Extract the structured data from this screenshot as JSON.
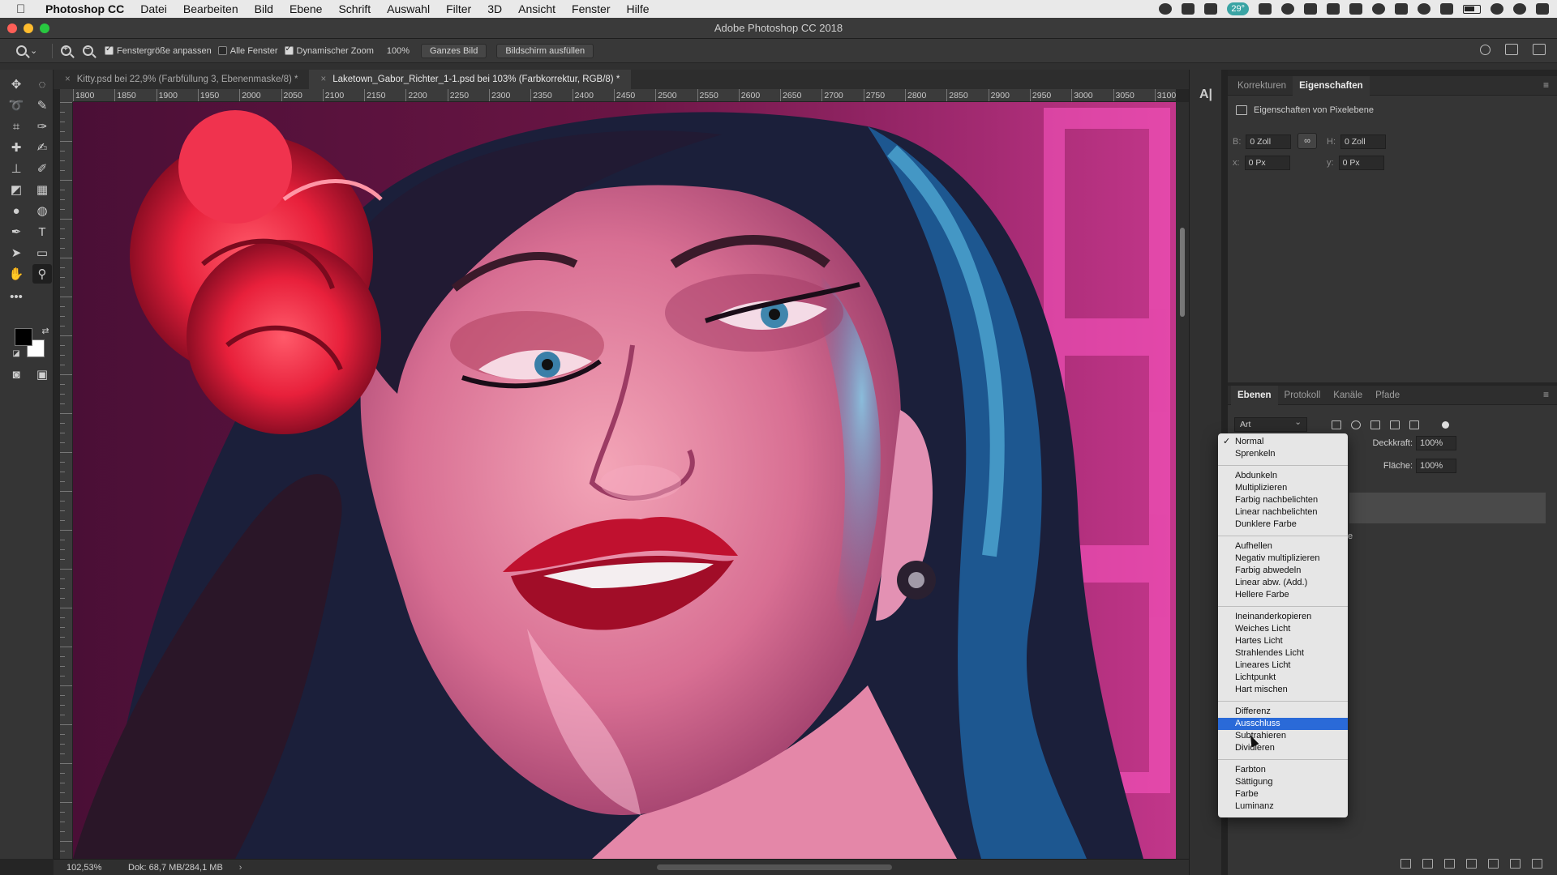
{
  "menubar": {
    "app": "Photoshop CC",
    "items": [
      "Datei",
      "Bearbeiten",
      "Bild",
      "Ebene",
      "Schrift",
      "Auswahl",
      "Filter",
      "3D",
      "Ansicht",
      "Fenster",
      "Hilfe"
    ],
    "badge": "29°"
  },
  "window": {
    "title": "Adobe Photoshop CC 2018"
  },
  "options": {
    "check1": "Fenstergröße anpassen",
    "check2": "Alle Fenster",
    "check3": "Dynamischer Zoom",
    "zoom": "100%",
    "btn1": "Ganzes Bild",
    "btn2": "Bildschirm ausfüllen"
  },
  "tabs": [
    {
      "label": "Kitty.psd bei 22,9% (Farbfüllung 3, Ebenenmaske/8) *"
    },
    {
      "label": "Laketown_Gabor_Richter_1-1.psd bei 103% (Farbkorrektur, RGB/8) *"
    }
  ],
  "ruler_h": [
    "1800",
    "1850",
    "1900",
    "1950",
    "2000",
    "2050",
    "2100",
    "2150",
    "2200",
    "2250",
    "2300",
    "2350",
    "2400",
    "2450",
    "2500",
    "2550",
    "2600",
    "2650",
    "2700",
    "2750",
    "2800",
    "2850",
    "2900",
    "2950",
    "3000",
    "3050",
    "3100"
  ],
  "status": {
    "zoom": "102,53%",
    "doc": "Dok: 68,7 MB/284,1 MB",
    "arrow": "›"
  },
  "props_panel": {
    "tabs": [
      "Korrekturen",
      "Eigenschaften"
    ],
    "header": "Eigenschaften von Pixelebene",
    "b_label": "B:",
    "b_value": "0 Zoll",
    "h_label": "H:",
    "h_value": "0 Zoll",
    "x_label": "x:",
    "x_value": "0 Px",
    "y_label": "y:",
    "y_value": "0 Px"
  },
  "layers_panel": {
    "tabs": [
      "Ebenen",
      "Protokoll",
      "Kanäle",
      "Pfade"
    ],
    "filter": "Art",
    "opacity_label": "Deckkraft:",
    "opacity_value": "100%",
    "fill_label": "Fläche:",
    "fill_value": "100%",
    "partial_text": "e"
  },
  "blend_menu": {
    "groups": [
      [
        "Normal",
        "Sprenkeln"
      ],
      [
        "Abdunkeln",
        "Multiplizieren",
        "Farbig nachbelichten",
        "Linear nachbelichten",
        "Dunklere Farbe"
      ],
      [
        "Aufhellen",
        "Negativ multiplizieren",
        "Farbig abwedeln",
        "Linear abw. (Add.)",
        "Hellere Farbe"
      ],
      [
        "Ineinanderkopieren",
        "Weiches Licht",
        "Hartes Licht",
        "Strahlendes Licht",
        "Lineares Licht",
        "Lichtpunkt",
        "Hart mischen"
      ],
      [
        "Differenz",
        "Ausschluss",
        "Subtrahieren",
        "Dividieren"
      ],
      [
        "Farbton",
        "Sättigung",
        "Farbe",
        "Luminanz"
      ]
    ],
    "checked": "Normal",
    "highlighted": "Ausschluss"
  },
  "colors": {
    "highlight": "#2a6ad8",
    "foreground": "#000000",
    "background": "#ffffff"
  }
}
